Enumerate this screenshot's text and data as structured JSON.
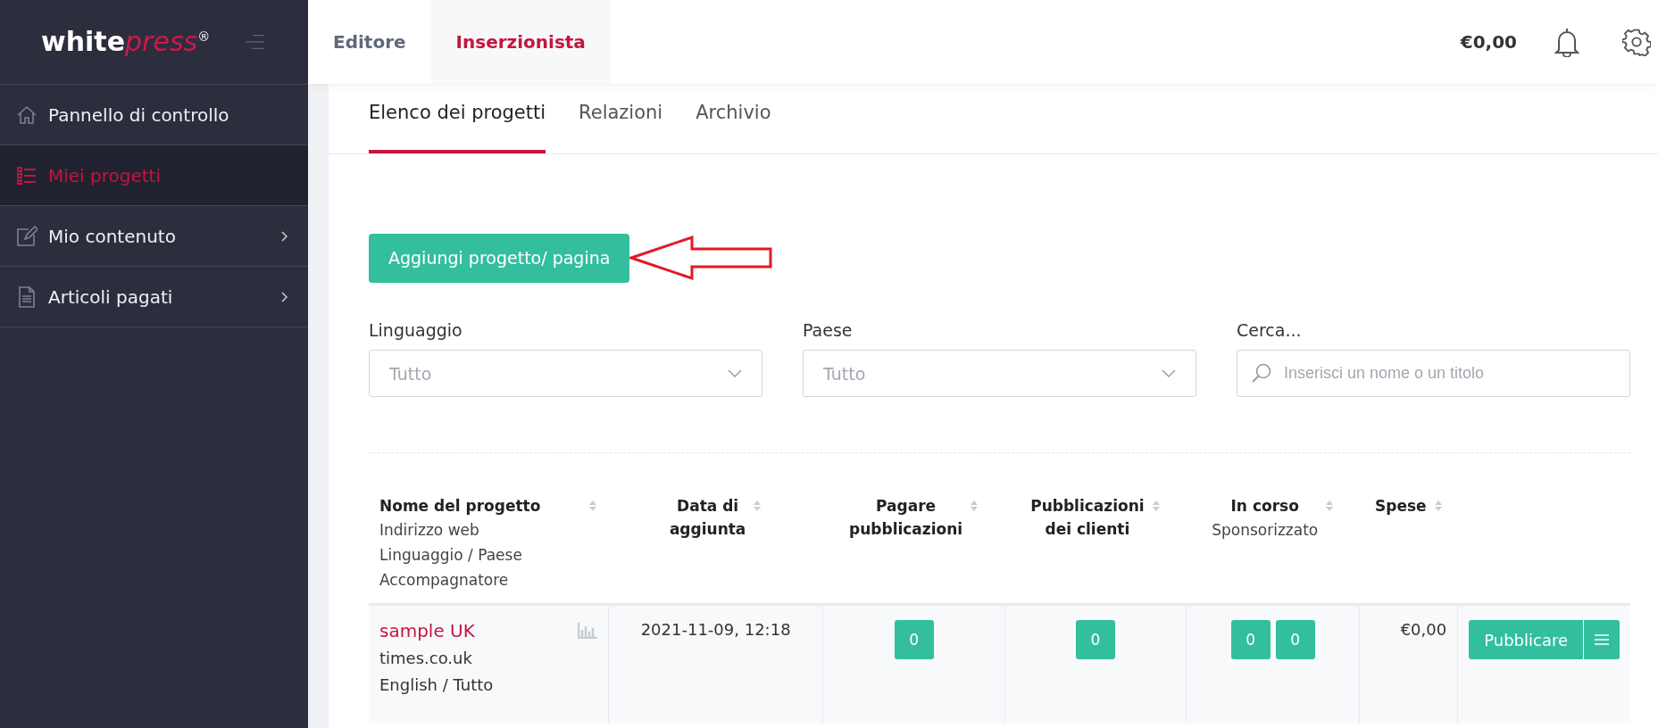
{
  "logo": {
    "main": "white",
    "accent": "press",
    "mark": "®"
  },
  "sidebar": {
    "items": [
      {
        "label": "Pannello di controllo",
        "kind": "home",
        "selected": false,
        "has_submenu": false
      },
      {
        "label": "Miei progetti",
        "kind": "list",
        "selected": true,
        "has_submenu": false
      },
      {
        "label": "Mio contenuto",
        "kind": "edit",
        "selected": false,
        "has_submenu": true
      },
      {
        "label": "Articoli pagati",
        "kind": "document",
        "selected": false,
        "has_submenu": true
      }
    ]
  },
  "topbar": {
    "roles": [
      {
        "label": "Editore",
        "selected": false
      },
      {
        "label": "Inserzionista",
        "selected": true
      }
    ],
    "balance": "€0,00"
  },
  "tabs": [
    {
      "label": "Elenco dei progetti",
      "selected": true
    },
    {
      "label": "Relazioni",
      "selected": false
    },
    {
      "label": "Archivio",
      "selected": false
    }
  ],
  "add_button": "Aggiungi progetto/ pagina",
  "filters": [
    {
      "kind": "select",
      "label": "Linguaggio",
      "value": "Tutto"
    },
    {
      "kind": "select",
      "label": "Paese",
      "value": "Tutto"
    },
    {
      "kind": "search",
      "label": "Cerca...",
      "placeholder": "Inserisci un nome o un titolo"
    }
  ],
  "table": {
    "columns": [
      {
        "lines": [
          "Nome del progetto"
        ],
        "sub": [
          "Indirizzo web",
          "Linguaggio / Paese",
          "Accompagnatore"
        ]
      },
      {
        "lines": [
          "Data di",
          "aggiunta"
        ]
      },
      {
        "lines": [
          "Pagare",
          "pubblicazioni"
        ]
      },
      {
        "lines": [
          "Pubblicazioni",
          "dei clienti"
        ]
      },
      {
        "lines": [
          "In corso"
        ],
        "sub": [
          "Sponsorizzato"
        ]
      },
      {
        "lines": [
          "Spese"
        ]
      }
    ],
    "rows": [
      {
        "name": "sample UK",
        "url": "times.co.uk",
        "lang": "English / Tutto",
        "date": "2021-11-09, 12:18",
        "pay": [
          "0"
        ],
        "client": [
          "0"
        ],
        "running": [
          "0",
          "0"
        ],
        "cost": "€0,00",
        "action": "Pubblicare"
      }
    ]
  }
}
